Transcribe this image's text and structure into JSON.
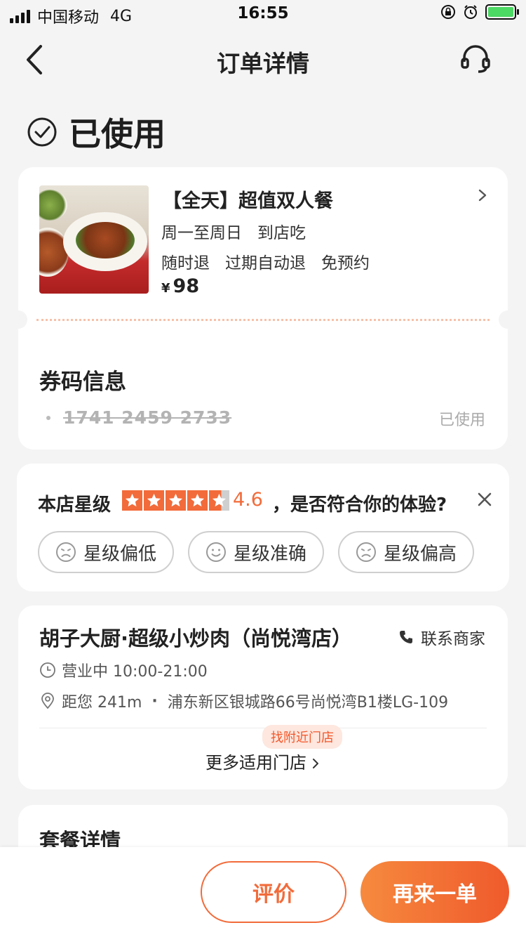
{
  "status_bar": {
    "carrier": "中国移动",
    "network": "4G",
    "time": "16:55",
    "battery_color": "#4cd964"
  },
  "nav": {
    "title": "订单详情",
    "back_icon": "chevron-left-icon",
    "service_icon": "headset-icon"
  },
  "order_status": {
    "label": "已使用",
    "icon": "check-circle-icon"
  },
  "deal": {
    "title": "【全天】超值双人餐",
    "schedule": [
      "周一至周日",
      "到店吃"
    ],
    "policies": [
      "随时退",
      "过期自动退",
      "免预约"
    ],
    "currency": "¥",
    "price": "98",
    "image": "dish-photo"
  },
  "coupon": {
    "section_title": "券码信息",
    "code": "1741 2459 2733",
    "status": "已使用"
  },
  "rating": {
    "label": "本店星级",
    "stars": 4.6,
    "score": "4.6",
    "question": "，是否符合你的体验?",
    "options": [
      {
        "label": "星级偏低",
        "icon": "sad-face-icon"
      },
      {
        "label": "星级准确",
        "icon": "smile-face-icon"
      },
      {
        "label": "星级偏高",
        "icon": "sad-face-icon"
      }
    ],
    "accent": "#f26b3a"
  },
  "shop": {
    "name": "胡子大厨·超级小炒肉（尚悦湾店）",
    "contact_label": "联系商家",
    "hours": "营业中 10:00-21:00",
    "distance": "距您 241m",
    "address": "浦东新区银城路66号尚悦湾B1楼LG-109",
    "nearby_badge": "找附近门店",
    "more_stores": "更多适用门店"
  },
  "package": {
    "title": "套餐详情"
  },
  "actions": {
    "review": "评价",
    "reorder": "再来一单"
  }
}
